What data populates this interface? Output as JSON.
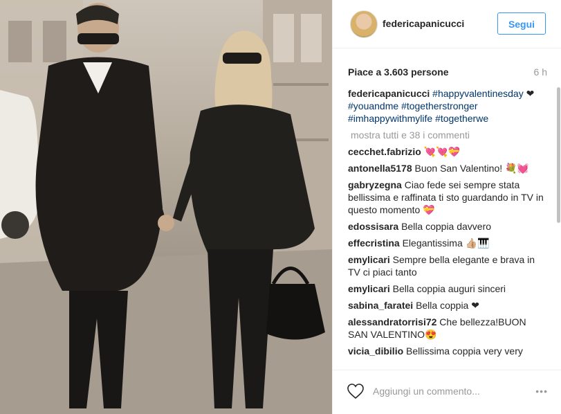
{
  "post": {
    "author": "federicapanicucci",
    "follow_label": "Segui",
    "likes": "Piace a 3.603 persone",
    "time": "6 h",
    "caption": {
      "user": "federicapanicucci",
      "tag1": "#happyvalentinesday",
      "heart": "❤",
      "tag2": "#youandme",
      "tag3": "#togetherstronger",
      "tag4": "#imhappywithmylife",
      "tag5": "#togetherwe"
    },
    "show_all": "mostra tutti e 38 i commenti",
    "comments": [
      {
        "user": "cecchet.fabrizio",
        "text": "💘💘💝"
      },
      {
        "user": "antonella5178",
        "text": "Buon San Valentino! 💐💓"
      },
      {
        "user": "gabryzegna",
        "text": "Ciao fede sei sempre stata bellissima e raffinata ti sto guardando in TV in questo momento 💝"
      },
      {
        "user": "edossisara",
        "text": "Bella coppia davvero"
      },
      {
        "user": "effecristina",
        "text": "Elegantissima 👍🏼🎹"
      },
      {
        "user": "emylicari",
        "text": "Sempre bella elegante e brava in TV ci piaci tanto"
      },
      {
        "user": "emylicari",
        "text": "Bella coppia auguri sinceri"
      },
      {
        "user": "sabina_faratei",
        "text": "Bella coppia ❤"
      },
      {
        "user": "alessandratorrisi72",
        "text": "Che bellezza!BUON SAN VALENTINO😍"
      },
      {
        "user": "vicia_dibilio",
        "text": "Bellissima coppia very very"
      }
    ],
    "add_comment_placeholder": "Aggiungi un commento...",
    "more_options": "•••"
  },
  "icons": {
    "like": "heart-outline-icon",
    "options": "ellipsis-icon"
  },
  "colors": {
    "accent": "#3897f0",
    "hashtag": "#003569",
    "muted": "#999999",
    "text": "#262626"
  }
}
